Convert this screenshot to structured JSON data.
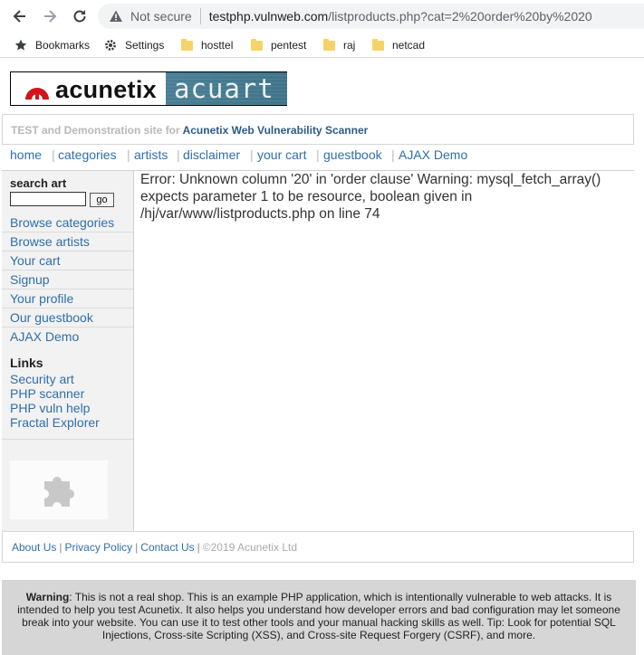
{
  "browser": {
    "security_label": "Not secure",
    "url_host": "testphp.vulnweb.com",
    "url_path": "/listproducts.php?cat=2%20order%20by%2020",
    "bookmarks": [
      {
        "label": "Bookmarks",
        "icon": "star-icon"
      },
      {
        "label": "Settings",
        "icon": "gear-icon"
      },
      {
        "label": "hosttel",
        "icon": "folder-icon"
      },
      {
        "label": "pentest",
        "icon": "folder-icon"
      },
      {
        "label": "raj",
        "icon": "folder-icon"
      },
      {
        "label": "netcad",
        "icon": "folder-icon"
      }
    ]
  },
  "logo": {
    "brand": "acunetix",
    "product": "acuart"
  },
  "tagline": {
    "prefix": "TEST and Demonstration site for",
    "product": "Acunetix Web Vulnerability Scanner"
  },
  "nav": [
    "home",
    "categories",
    "artists",
    "disclaimer",
    "your cart",
    "guestbook",
    "AJAX Demo"
  ],
  "sidebar": {
    "search_title": "search art",
    "search_value": "",
    "go_label": "go",
    "links": [
      "Browse categories",
      "Browse artists",
      "Your cart",
      "Signup",
      "Your profile",
      "Our guestbook",
      "AJAX Demo"
    ],
    "links_title": "Links",
    "external_links": [
      "Security art",
      "PHP scanner",
      "PHP vuln help",
      "Fractal Explorer"
    ]
  },
  "content": {
    "error": "Error: Unknown column '20' in 'order clause' Warning: mysql_fetch_array() expects parameter 1 to be resource, boolean given in /hj/var/www/listproducts.php on line 74"
  },
  "footer": {
    "links": [
      "About Us",
      "Privacy Policy",
      "Contact Us"
    ],
    "copyright": "©2019 Acunetix Ltd"
  },
  "warning": {
    "label": "Warning",
    "text": ": This is not a real shop. This is an example PHP application, which is intentionally vulnerable to web attacks. It is intended to help you test Acunetix. It also helps you understand how developer errors and bad configuration may let someone break into your website. You can use it to test other tools and your manual hacking skills as well. Tip: Look for potential SQL Injections, Cross-site Scripting (XSS), and Cross-site Request Forgery (CSRF), and more."
  },
  "colors": {
    "link": "#2f6fa8",
    "logo_red": "#d2131a",
    "logo_panel": "#457a90"
  }
}
